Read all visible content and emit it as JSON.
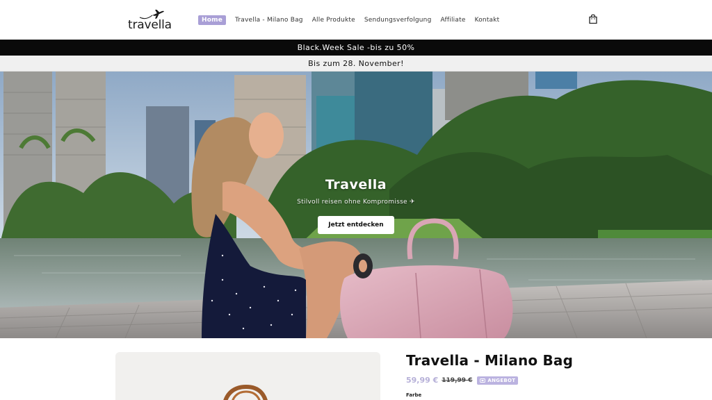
{
  "header": {
    "logo_text": "travella",
    "nav": [
      {
        "label": "Home",
        "active": true
      },
      {
        "label": "Travella - Milano Bag",
        "active": false
      },
      {
        "label": "Alle Produkte",
        "active": false
      },
      {
        "label": "Sendungsverfolgung",
        "active": false
      },
      {
        "label": "Affiliate",
        "active": false
      },
      {
        "label": "Kontakt",
        "active": false
      }
    ],
    "cart_icon": "shopping-bag-icon"
  },
  "announcements": {
    "primary": "Black.Week Sale -bis zu 50%",
    "secondary": "Bis zum 28. November!"
  },
  "hero": {
    "title": "Travella",
    "subtitle": "Stilvoll reisen ohne Kompromisse ✈",
    "cta_label": "Jetzt entdecken"
  },
  "product": {
    "title": "Travella - Milano Bag",
    "price_sale": "59,99 €",
    "price_original": "119,99 €",
    "badge": "ANGEBOT",
    "option_label": "Farbe"
  },
  "colors": {
    "accent": "#a99fd6",
    "announcement_bg": "#0a0a0a",
    "price_sale": "#b6b0d8"
  }
}
